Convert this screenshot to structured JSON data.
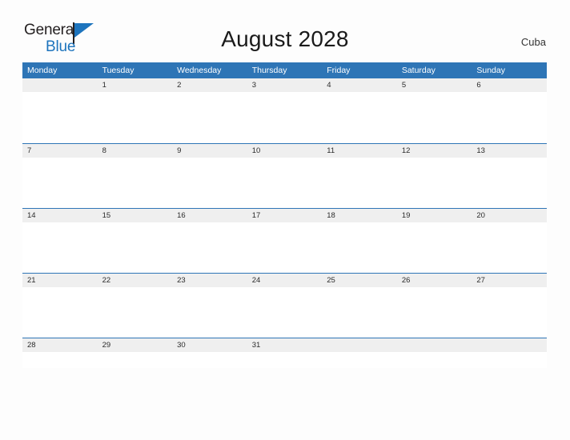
{
  "logo": {
    "word_top": "General",
    "word_bottom": "Blue",
    "flag_color": "#1d74bd",
    "text_color": "#231f20"
  },
  "header": {
    "title": "August 2028",
    "country": "Cuba"
  },
  "calendar": {
    "header_bg": "#2e75b6",
    "header_text_color": "#ffffff",
    "daynum_bg": "#efefef",
    "daynum_text_color": "#2b2b2b",
    "weekday_headers": [
      "Monday",
      "Tuesday",
      "Wednesday",
      "Thursday",
      "Friday",
      "Saturday",
      "Sunday"
    ],
    "weeks": [
      [
        "",
        "1",
        "2",
        "3",
        "4",
        "5",
        "6"
      ],
      [
        "7",
        "8",
        "9",
        "10",
        "11",
        "12",
        "13"
      ],
      [
        "14",
        "15",
        "16",
        "17",
        "18",
        "19",
        "20"
      ],
      [
        "21",
        "22",
        "23",
        "24",
        "25",
        "26",
        "27"
      ],
      [
        "28",
        "29",
        "30",
        "31",
        "",
        "",
        ""
      ]
    ]
  }
}
